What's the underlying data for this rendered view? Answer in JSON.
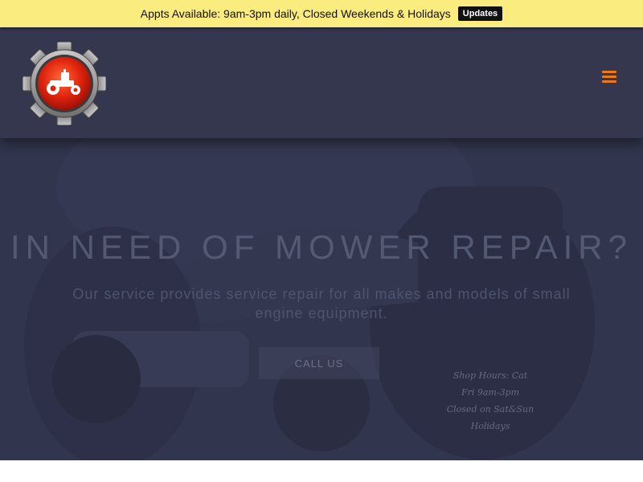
{
  "announcement": {
    "text": "Appts Available: 9am-3pm daily, Closed Weekends & Holidays",
    "button_label": "Updates"
  },
  "header": {
    "logo_icon": "gear-tractor-logo",
    "menu_icon": "hamburger-menu-icon"
  },
  "hero": {
    "title": "IN NEED OF MOWER REPAIR?",
    "subtitle": "Our service provides service repair for all makes and models of small engine equipment.",
    "button_label": "CALL US",
    "handwritten_note": [
      "Shop Hours: Cat",
      "Fri 9am-3pm",
      "Closed on Sat&Sun",
      "Holidays"
    ]
  },
  "colors": {
    "announcement_bg": "#fbec7f",
    "header_bg": "#34374e",
    "accent": "#f07a10"
  }
}
